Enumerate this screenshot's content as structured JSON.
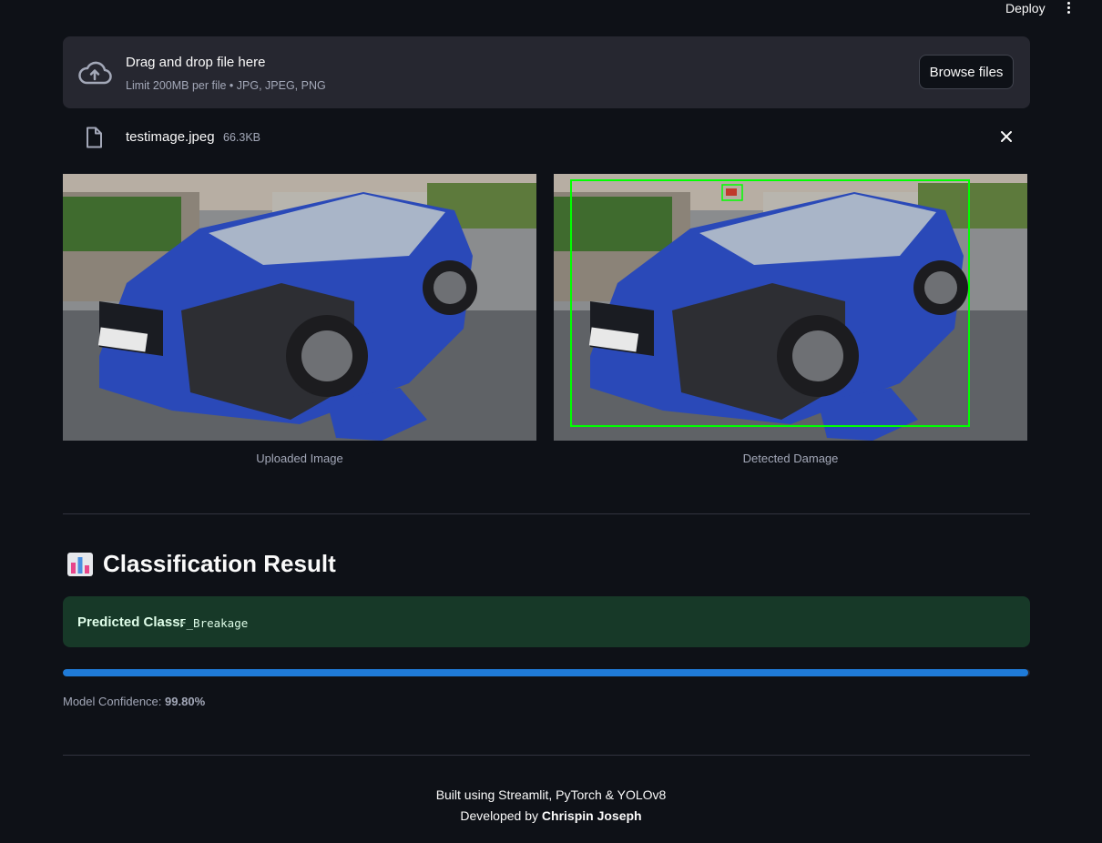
{
  "header": {
    "deploy_label": "Deploy",
    "menu_icon": "kebab-menu-icon"
  },
  "uploader": {
    "icon": "cloud-upload-icon",
    "title": "Drag and drop file here",
    "subtitle": "Limit 200MB per file • JPG, JPEG, PNG",
    "browse_label": "Browse files"
  },
  "file": {
    "icon": "file-icon",
    "name": "testimage.jpeg",
    "size": "66.3KB",
    "remove_icon": "close-icon"
  },
  "images": [
    {
      "caption": "Uploaded Image"
    },
    {
      "caption": "Detected Damage"
    }
  ],
  "result": {
    "icon": "bar-chart-emoji",
    "heading": "Classification Result",
    "predicted_label": "Predicted Class:",
    "predicted_value": "F_Breakage",
    "confidence_label": "Model Confidence:",
    "confidence_value": "99.80%",
    "confidence_fraction": 0.998
  },
  "footer": {
    "line1": "Built using Streamlit, PyTorch & YOLOv8",
    "line2_prefix": "Developed by",
    "author": "Chrispin Joseph"
  },
  "colors": {
    "background": "#0e1117",
    "success_bg": "#173928",
    "progress": "#1f7bd8",
    "detection_box": "#00ff00"
  }
}
